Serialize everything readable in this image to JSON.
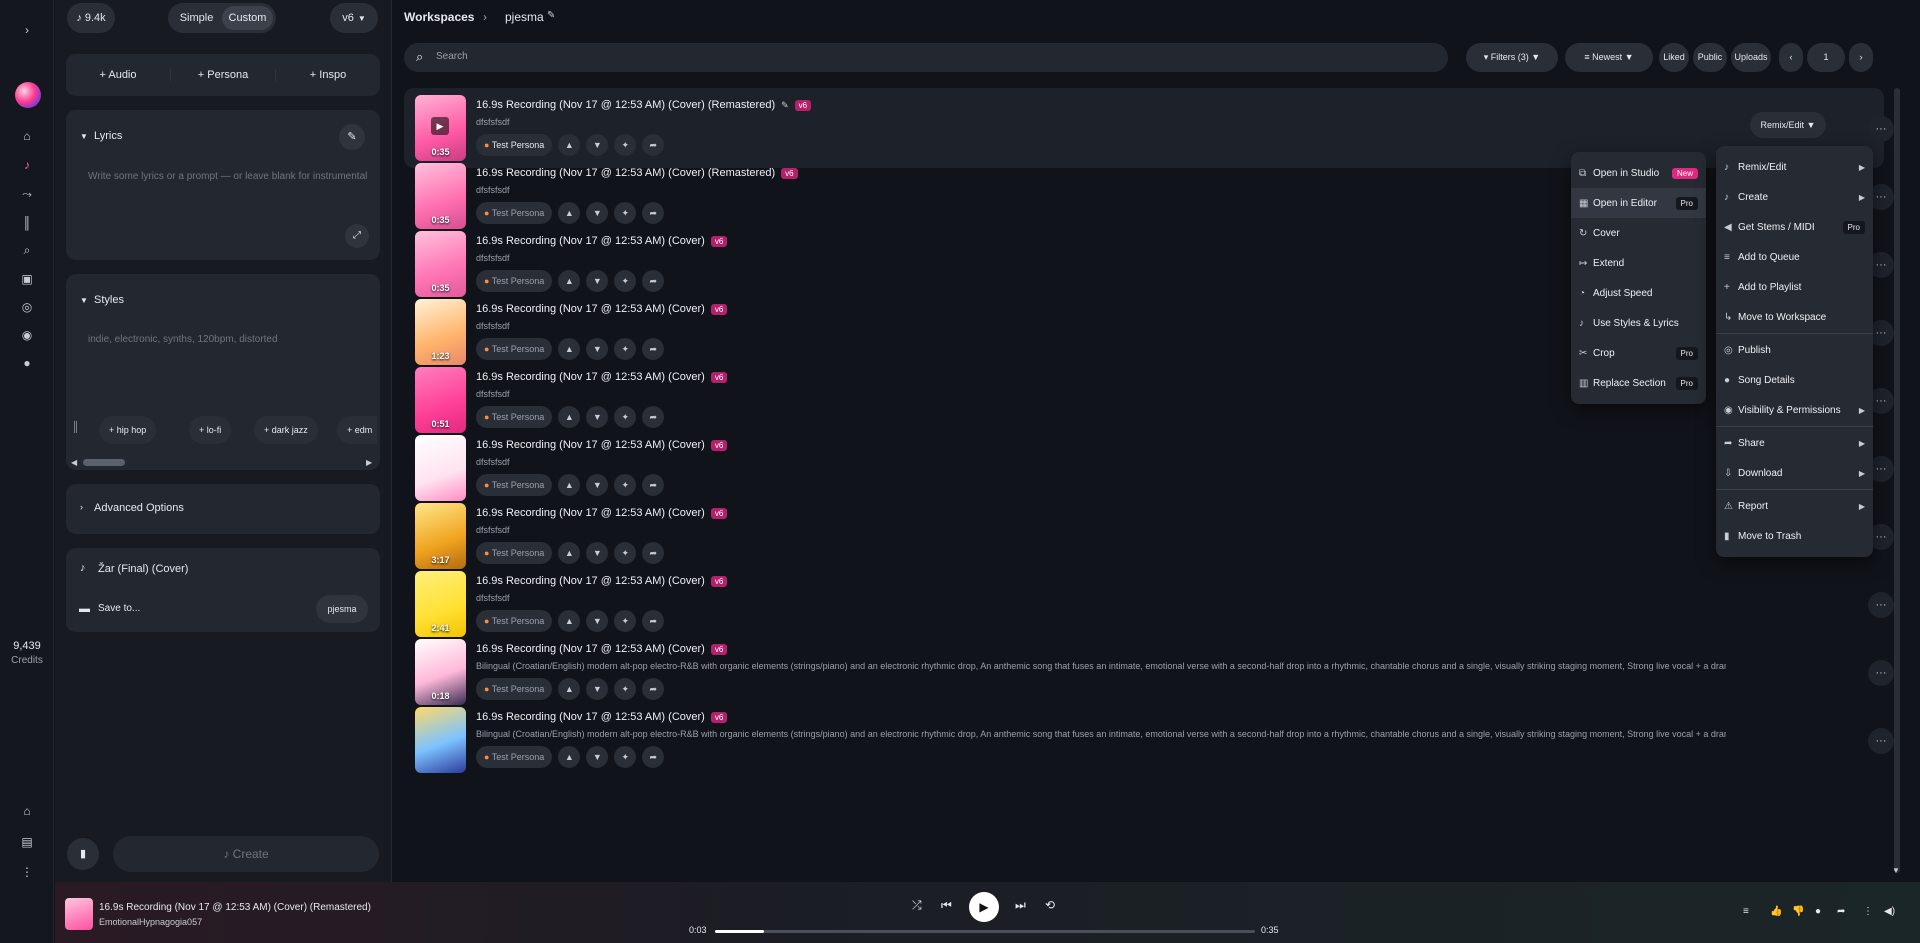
{
  "topbar": {
    "credits_count": "9.4k",
    "mode_simple": "Simple",
    "mode_custom": "Custom",
    "version": "v6"
  },
  "sidebar": {
    "credits_value": "9,439",
    "credits_label": "Credits"
  },
  "create": {
    "audio": "Audio",
    "persona": "Persona",
    "inspo": "Inspo",
    "lyrics_label": "Lyrics",
    "lyrics_placeholder": "Write some lyrics or a prompt — or leave blank for instrumental",
    "styles_label": "Styles",
    "styles_placeholder": "indie, electronic, synths, 120bpm, distorted",
    "style_chips": [
      "hip hop",
      "lo-fi",
      "dark jazz",
      "edm"
    ],
    "advanced": "Advanced Options",
    "song_title": "Žar (Final) (Cover)",
    "save_to": "Save to...",
    "workspace": "pjesma",
    "create_button": "Create"
  },
  "header": {
    "breadcrumb_root": "Workspaces",
    "breadcrumb_current": "pjesma"
  },
  "toolbar": {
    "search_placeholder": "Search",
    "filters": "Filters (3)",
    "sort": "Newest",
    "liked": "Liked",
    "public": "Public",
    "uploads": "Uploads",
    "page": "1",
    "remix_edit": "Remix/Edit"
  },
  "songs": [
    {
      "title": "16.9s Recording (Nov 17 @ 12:53 AM) (Cover) (Remastered)",
      "badge": "v6",
      "desc": "dfsfsfsdf",
      "duration": "0:35",
      "persona": "Test Persona"
    },
    {
      "title": "16.9s Recording (Nov 17 @ 12:53 AM) (Cover) (Remastered)",
      "badge": "v6",
      "desc": "dfsfsfsdf",
      "duration": "0:35",
      "persona": "Test Persona"
    },
    {
      "title": "16.9s Recording (Nov 17 @ 12:53 AM) (Cover)",
      "badge": "v6",
      "desc": "dfsfsfsdf",
      "duration": "0:35",
      "persona": "Test Persona"
    },
    {
      "title": "16.9s Recording (Nov 17 @ 12:53 AM) (Cover)",
      "badge": "v6",
      "desc": "dfsfsfsdf",
      "duration": "1:23",
      "persona": "Test Persona"
    },
    {
      "title": "16.9s Recording (Nov 17 @ 12:53 AM) (Cover)",
      "badge": "v6",
      "desc": "dfsfsfsdf",
      "duration": "0:51",
      "persona": "Test Persona"
    },
    {
      "title": "16.9s Recording (Nov 17 @ 12:53 AM) (Cover)",
      "badge": "v6",
      "desc": "dfsfsfsdf",
      "duration": "",
      "persona": "Test Persona"
    },
    {
      "title": "16.9s Recording (Nov 17 @ 12:53 AM) (Cover)",
      "badge": "v6",
      "desc": "dfsfsfsdf",
      "duration": "3:17",
      "persona": "Test Persona"
    },
    {
      "title": "16.9s Recording (Nov 17 @ 12:53 AM) (Cover)",
      "badge": "v6",
      "desc": "dfsfsfsdf",
      "duration": "2:41",
      "persona": "Test Persona"
    },
    {
      "title": "16.9s Recording (Nov 17 @ 12:53 AM) (Cover)",
      "badge": "v6",
      "desc": "Bilingual (Croatian/English) modern alt-pop electro-R&B with organic elements (strings/piano) and an electronic rhythmic drop, An anthemic song that fuses an intimate, emotional verse with a second-half drop into a rhythmic, chantable chorus and a single, visually striking staging moment, Strong live vocal + a dramatic, repeatabl...",
      "duration": "0:18",
      "persona": "Test Persona"
    },
    {
      "title": "16.9s Recording (Nov 17 @ 12:53 AM) (Cover)",
      "badge": "v6",
      "desc": "Bilingual (Croatian/English) modern alt-pop electro-R&B with organic elements (strings/piano) and an electronic rhythmic drop, An anthemic song that fuses an intimate, emotional verse with a second-half drop into a rhythmic, chantable chorus and a single, visually striking staging moment, Strong live vocal + a dramatic, repeatabl...",
      "duration": "",
      "persona": "Test Persona"
    }
  ],
  "submenu": [
    {
      "label": "Open in Studio",
      "tag": "New"
    },
    {
      "label": "Open in Editor",
      "tag": "Pro"
    },
    {
      "label": "Cover",
      "tag": ""
    },
    {
      "label": "Extend",
      "tag": ""
    },
    {
      "label": "Adjust Speed",
      "tag": ""
    },
    {
      "label": "Use Styles & Lyrics",
      "tag": ""
    },
    {
      "label": "Crop",
      "tag": "Pro"
    },
    {
      "label": "Replace Section",
      "tag": "Pro"
    }
  ],
  "context_menu": [
    {
      "label": "Remix/Edit",
      "tag": "",
      "arrow": true
    },
    {
      "label": "Create",
      "tag": "",
      "arrow": true
    },
    {
      "label": "Get Stems / MIDI",
      "tag": "Pro",
      "arrow": false
    },
    {
      "label": "Add to Queue",
      "tag": "",
      "arrow": false
    },
    {
      "label": "Add to Playlist",
      "tag": "",
      "arrow": false
    },
    {
      "label": "Move to Workspace",
      "tag": "",
      "arrow": false
    },
    {
      "label": "Publish",
      "tag": "",
      "arrow": false
    },
    {
      "label": "Song Details",
      "tag": "",
      "arrow": false
    },
    {
      "label": "Visibility & Permissions",
      "tag": "",
      "arrow": true
    },
    {
      "label": "Share",
      "tag": "",
      "arrow": true
    },
    {
      "label": "Download",
      "tag": "",
      "arrow": true
    },
    {
      "label": "Report",
      "tag": "",
      "arrow": true
    },
    {
      "label": "Move to Trash",
      "tag": "",
      "arrow": false
    }
  ],
  "player": {
    "title": "16.9s Recording (Nov 17 @ 12:53 AM) (Cover) (Remastered)",
    "artist": "EmotionalHypnagogia057",
    "elapsed": "0:03",
    "total": "0:35",
    "progress": 0.09
  },
  "colors": {
    "accent": "#e0287e",
    "bg": "#101319",
    "panel": "#23272f"
  }
}
